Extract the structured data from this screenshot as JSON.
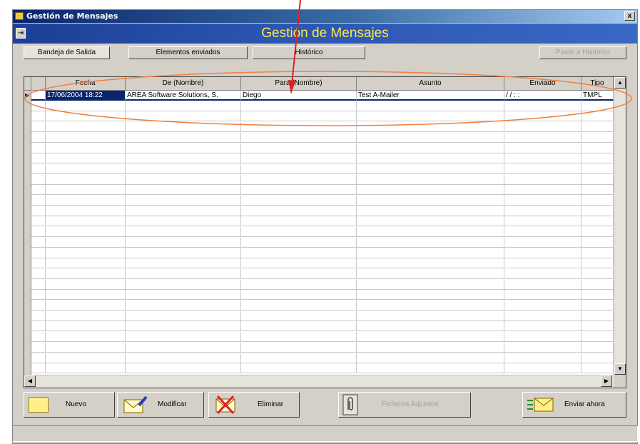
{
  "window": {
    "title": "Gestión de Mensajes",
    "close_label": "x"
  },
  "banner": {
    "title": "Gestión de Mensajes",
    "exit_icon": "exit-door-icon"
  },
  "tabs": [
    {
      "label": "Bandeja de Salida",
      "active": true
    },
    {
      "label": "Elementos enviados",
      "active": false
    },
    {
      "label": "Histórico",
      "active": false
    }
  ],
  "history_button": {
    "label": "Pasar a Histórico",
    "enabled": false
  },
  "grid": {
    "columns": [
      "Fecha",
      "De (Nombre)",
      "Para (Nombre)",
      "Asunto",
      "Enviado",
      "Tipo"
    ],
    "rows": [
      {
        "fecha": "17/06/2004 18:22",
        "de": "AREA Software Solutions, S.",
        "para": "Diego",
        "asunto": "Test A-Mailer",
        "enviado": "/ /   : :",
        "tipo": "TMPL"
      }
    ]
  },
  "buttons": {
    "nuevo": "Nuevo",
    "modificar": "Modificar",
    "eliminar": "Eliminar",
    "adjunto": "Ficheros Adjuntos",
    "enviar": "Enviar ahora"
  },
  "colors": {
    "title_bar": "#0a246a",
    "banner_bg": "#2a55b0",
    "banner_text": "#ffe84a",
    "selection": "#0a246a",
    "annotation": "#e02020",
    "highlight_ellipse": "#f08040"
  }
}
